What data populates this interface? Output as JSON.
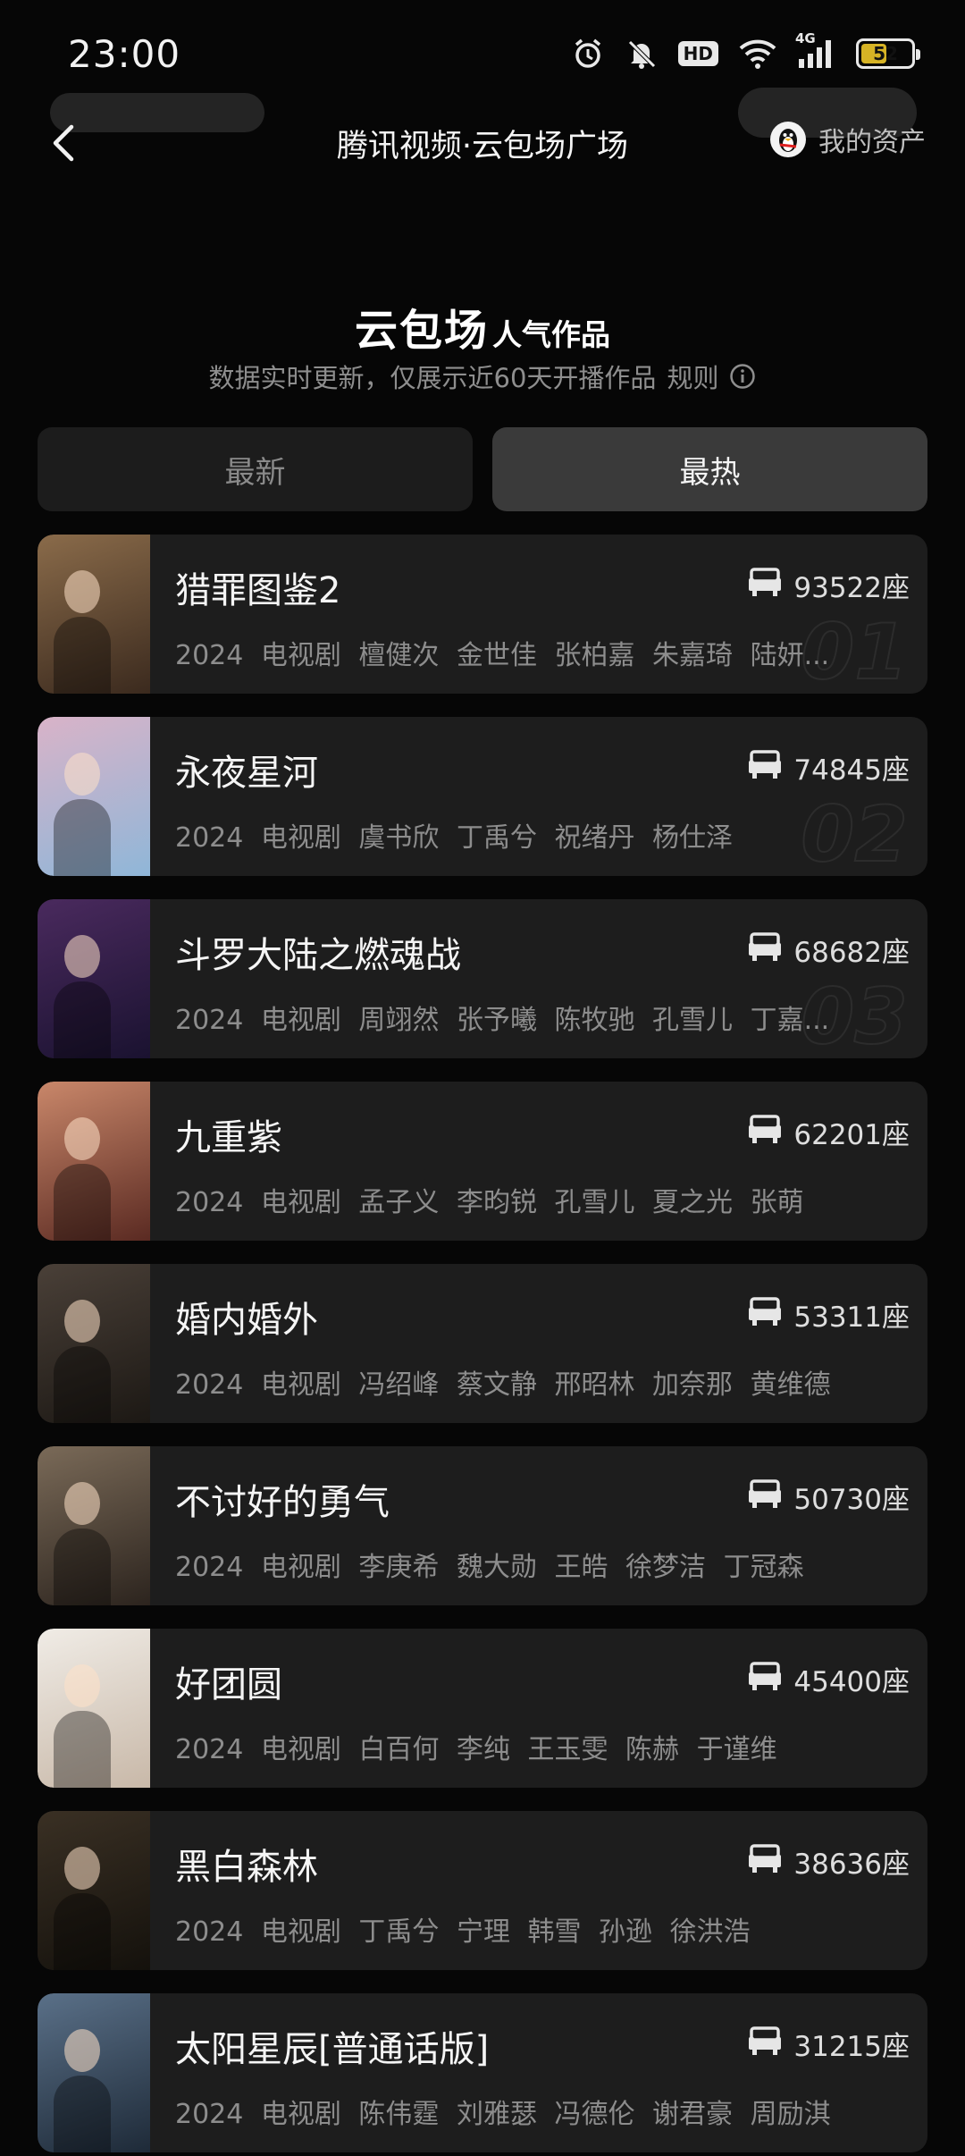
{
  "status_bar": {
    "time": "23:00",
    "network": "4G",
    "hd": "HD",
    "battery": "52",
    "battery_level": 0.52
  },
  "header": {
    "title": "腾讯视频·云包场广场",
    "assets_label": "我的资产"
  },
  "hero": {
    "title": "云包场",
    "subtitle": "人气作品",
    "description": "数据实时更新，仅展示近60天开播作品",
    "rules_label": "规则"
  },
  "tabs": [
    {
      "label": "最新",
      "active": false
    },
    {
      "label": "最热",
      "active": true
    }
  ],
  "items": [
    {
      "title": "猎罪图鉴2",
      "seats": "93522座",
      "meta": "2024 电视剧 檀健次 金世佳 张柏嘉 朱嘉琦 陆妍...",
      "rank": "01",
      "poster_colors": [
        "#8a6b4a",
        "#3b2a1e"
      ]
    },
    {
      "title": "永夜星河",
      "seats": "74845座",
      "meta": "2024 电视剧 虞书欣 丁禹兮 祝绪丹 杨仕泽",
      "rank": "02",
      "poster_colors": [
        "#d9b3c8",
        "#8fb6d8"
      ]
    },
    {
      "title": "斗罗大陆之燃魂战",
      "seats": "68682座",
      "meta": "2024 电视剧 周翊然 张予曦 陈牧驰 孔雪儿 丁嘉...",
      "rank": "03",
      "poster_colors": [
        "#4a2a5e",
        "#1a1230"
      ]
    },
    {
      "title": "九重紫",
      "seats": "62201座",
      "meta": "2024 电视剧 孟子义 李昀锐 孔雪儿 夏之光 张萌",
      "rank": "",
      "poster_colors": [
        "#c9876a",
        "#5a2a22"
      ]
    },
    {
      "title": "婚内婚外",
      "seats": "53311座",
      "meta": "2024 电视剧 冯绍峰 蔡文静 邢昭林 加奈那 黄维德",
      "rank": "",
      "poster_colors": [
        "#4a4038",
        "#1c1814"
      ]
    },
    {
      "title": "不讨好的勇气",
      "seats": "50730座",
      "meta": "2024 电视剧 李庚希 魏大勋 王皓 徐梦洁 丁冠森",
      "rank": "",
      "poster_colors": [
        "#7a6a58",
        "#2c241e"
      ]
    },
    {
      "title": "好团圆",
      "seats": "45400座",
      "meta": "2024 电视剧 白百何 李纯 王玉雯 陈赫 于谨维",
      "rank": "",
      "poster_colors": [
        "#f0ece6",
        "#c8b8a8"
      ]
    },
    {
      "title": "黑白森林",
      "seats": "38636座",
      "meta": "2024 电视剧 丁禹兮 宁理 韩雪 孙逊 徐洪浩",
      "rank": "",
      "poster_colors": [
        "#3a3024",
        "#14110c"
      ]
    },
    {
      "title": "太阳星辰[普通话版]",
      "seats": "31215座",
      "meta": "2024 电视剧 陈伟霆 刘雅瑟 冯德伦 谢君豪 周励淇",
      "rank": "",
      "poster_colors": [
        "#5a7088",
        "#1e2a38"
      ]
    }
  ]
}
